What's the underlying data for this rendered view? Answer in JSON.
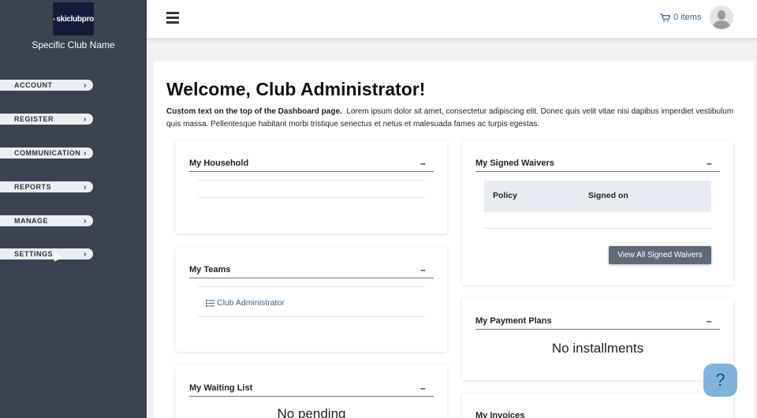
{
  "sidebar": {
    "logo_text": "skiclubpro",
    "club_name": "Specific Club Name",
    "items": [
      {
        "label": "ACCOUNT"
      },
      {
        "label": "REGISTER"
      },
      {
        "label": "COMMUNICATION"
      },
      {
        "label": "REPORTS"
      },
      {
        "label": "MANAGE"
      },
      {
        "label": "SETTINGS"
      }
    ]
  },
  "header": {
    "menu_icon": "hamburger-icon",
    "cart_label": "0 items",
    "cart_icon": "cart-icon",
    "avatar_icon": "user-avatar-icon"
  },
  "main": {
    "title": "Welcome, Club Administrator!",
    "intro_bold": "Custom text on the top of the Dashboard page.",
    "intro_text": "Lorem ipsum dolor sit amet, consectetur adipiscing elit. Donec quis velit vitae nisi dapibus imperdiet vestibulum quis massa. Pellentesque habitant morbi tristique senectus et netus et malesuada fames ac turpis egestas."
  },
  "cards": {
    "household": {
      "title": "My Household",
      "toggle": "–"
    },
    "teams": {
      "title": "My Teams",
      "toggle": "–",
      "link": "Club Administrator"
    },
    "waiting": {
      "title": "My Waiting List",
      "toggle": "–",
      "message": "No pending"
    },
    "waivers": {
      "title": "My Signed Waivers",
      "toggle": "–",
      "col_policy": "Policy",
      "col_signed": "Signed on",
      "button": "View All Signed Waivers"
    },
    "payment": {
      "title": "My Payment Plans",
      "toggle": "–",
      "message": "No installments"
    },
    "invoices": {
      "title": "My Invoices"
    }
  },
  "help": {
    "label": "?"
  },
  "colors": {
    "sidebar_bg": "#3b4350",
    "link": "#3b5f8a",
    "button": "#5e6b77",
    "help_bg": "#7fb5dd"
  }
}
